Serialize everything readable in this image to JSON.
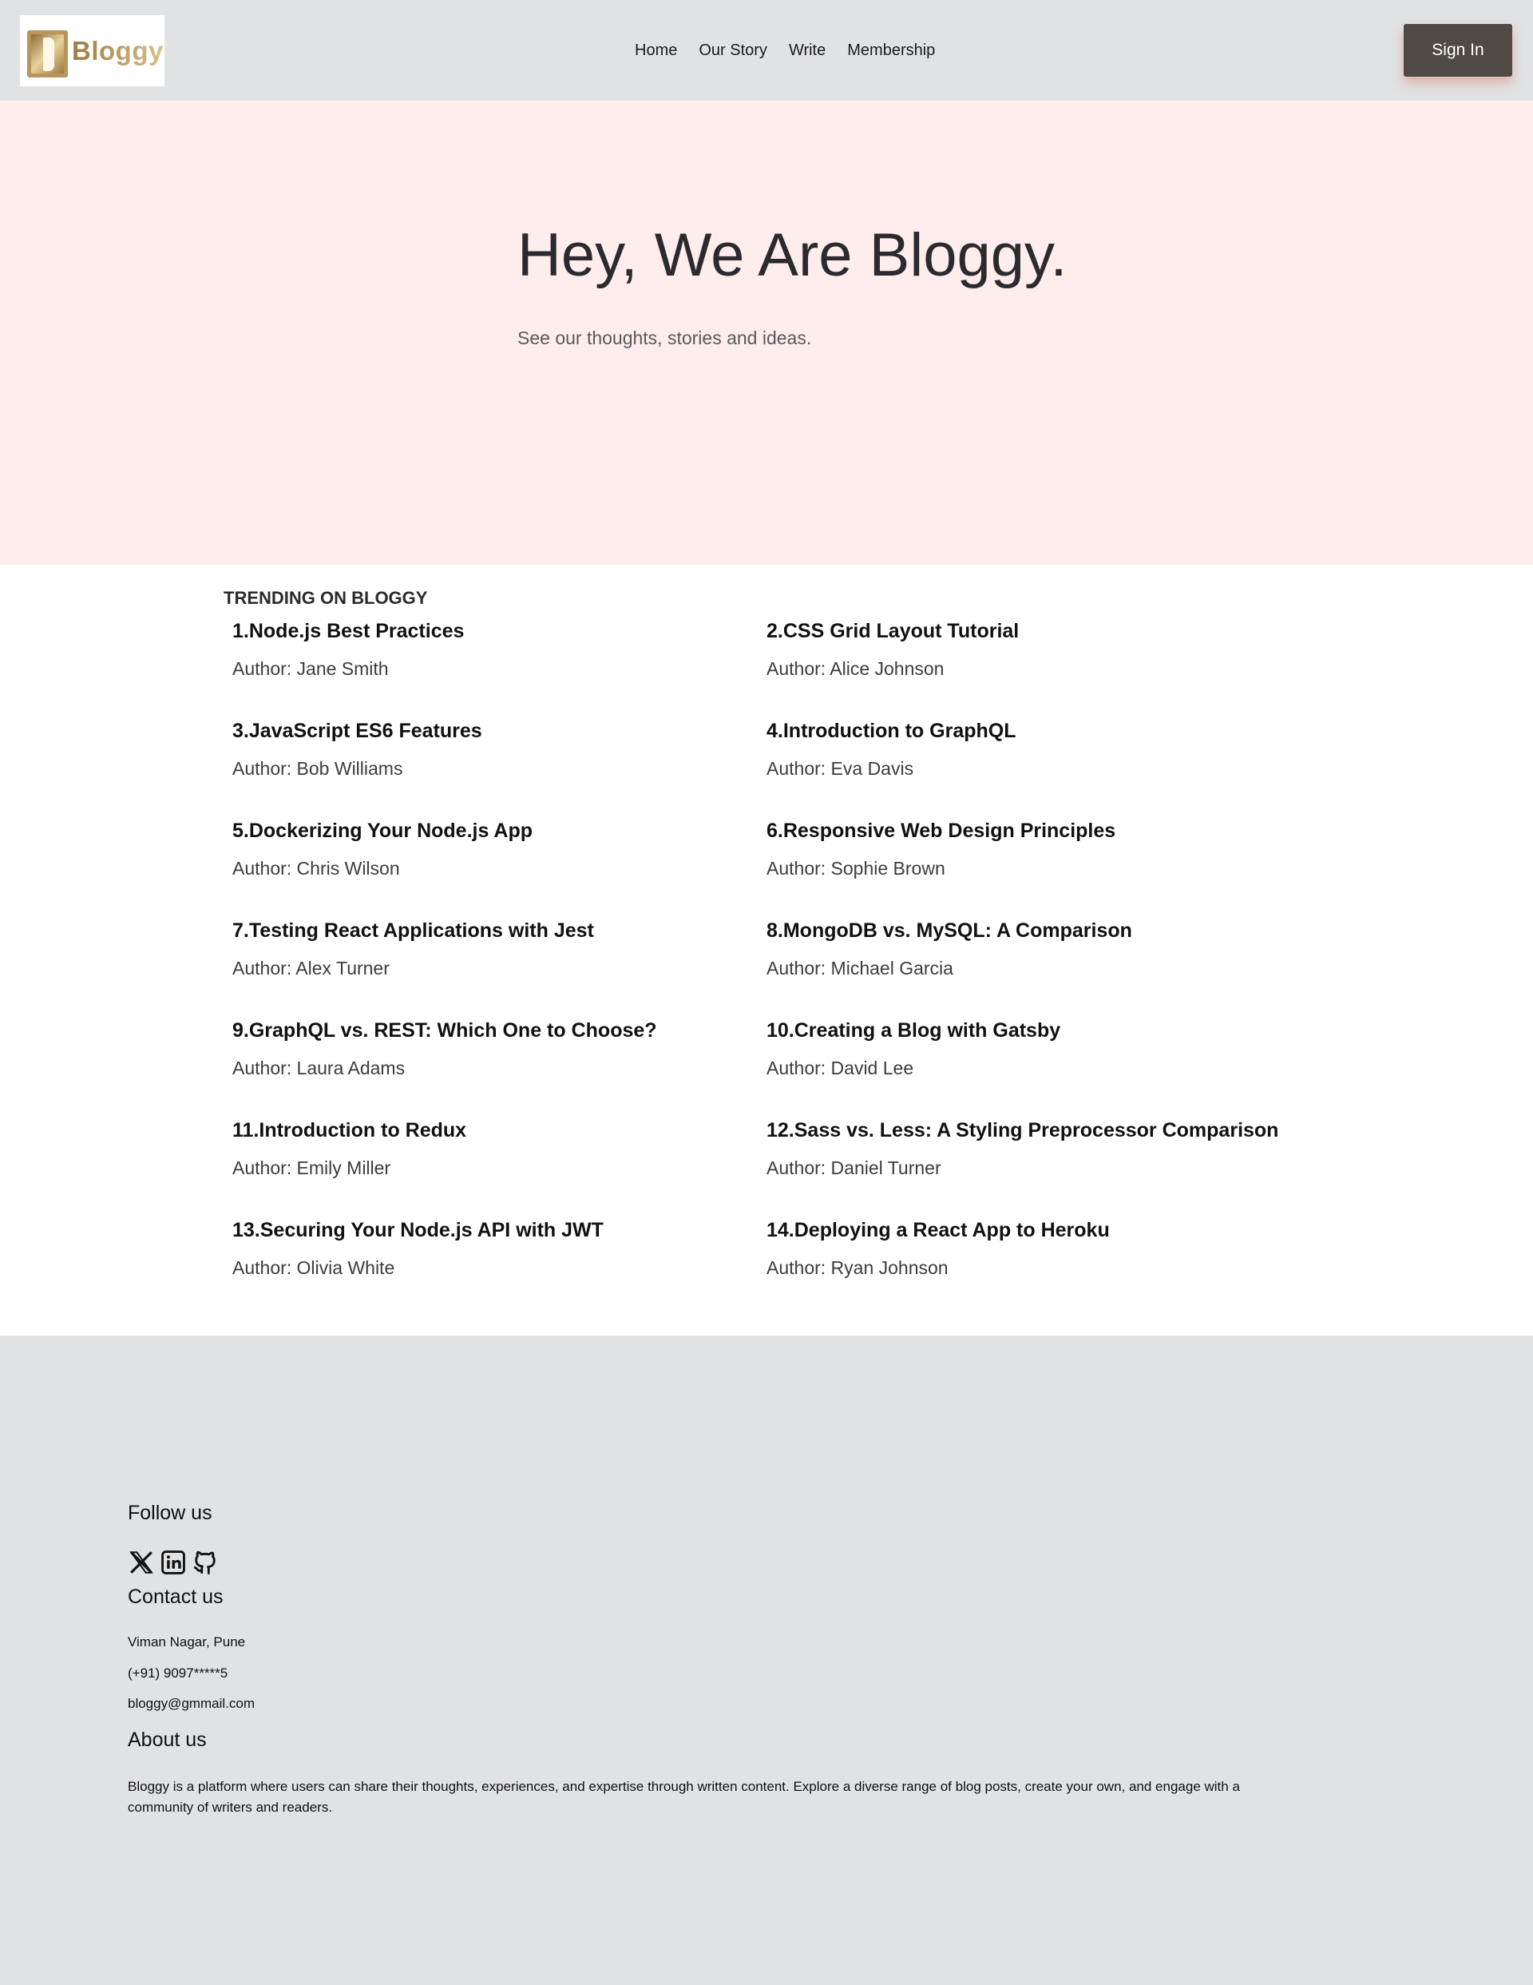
{
  "header": {
    "logo_text": "Bloggy",
    "nav": [
      "Home",
      "Our Story",
      "Write",
      "Membership"
    ],
    "signin_label": "Sign In"
  },
  "hero": {
    "title": "Hey, We Are Bloggy.",
    "subtitle": "See our thoughts, stories and ideas."
  },
  "trending": {
    "heading": "TRENDING ON BLOGGY",
    "posts": [
      {
        "title": "1.Node.js Best Practices",
        "author": "Author: Jane Smith"
      },
      {
        "title": "2.CSS Grid Layout Tutorial",
        "author": "Author: Alice Johnson"
      },
      {
        "title": "3.JavaScript ES6 Features",
        "author": "Author: Bob Williams"
      },
      {
        "title": "4.Introduction to GraphQL",
        "author": "Author: Eva Davis"
      },
      {
        "title": "5.Dockerizing Your Node.js App",
        "author": "Author: Chris Wilson"
      },
      {
        "title": "6.Responsive Web Design Principles",
        "author": "Author: Sophie Brown"
      },
      {
        "title": "7.Testing React Applications with Jest",
        "author": "Author: Alex Turner"
      },
      {
        "title": "8.MongoDB vs. MySQL: A Comparison",
        "author": "Author: Michael Garcia"
      },
      {
        "title": "9.GraphQL vs. REST: Which One to Choose?",
        "author": "Author: Laura Adams"
      },
      {
        "title": "10.Creating a Blog with Gatsby",
        "author": "Author: David Lee"
      },
      {
        "title": "11.Introduction to Redux",
        "author": "Author: Emily Miller"
      },
      {
        "title": "12.Sass vs. Less: A Styling Preprocessor Comparison",
        "author": "Author: Daniel Turner"
      },
      {
        "title": "13.Securing Your Node.js API with JWT",
        "author": "Author: Olivia White"
      },
      {
        "title": "14.Deploying a React App to Heroku",
        "author": "Author: Ryan Johnson"
      }
    ]
  },
  "footer": {
    "follow_heading": "Follow us",
    "socials": [
      "x-icon",
      "linkedin-icon",
      "github-icon"
    ],
    "contact_heading": "Contact us",
    "address": "Viman Nagar, Pune",
    "phone": "(+91) 9097*****5",
    "email": "bloggy@gmmail.com",
    "about_heading": "About us",
    "about_text": "Bloggy is a platform where users can share their thoughts, experiences, and expertise through written content. Explore a diverse range of blog posts, create your own, and engage with a community of writers and readers."
  },
  "colors": {
    "header_bg": "#e1e2e4",
    "hero_bg": "#ffeced",
    "signin_bg": "#4f4a45",
    "footer_bg": "#e1e2e4"
  }
}
